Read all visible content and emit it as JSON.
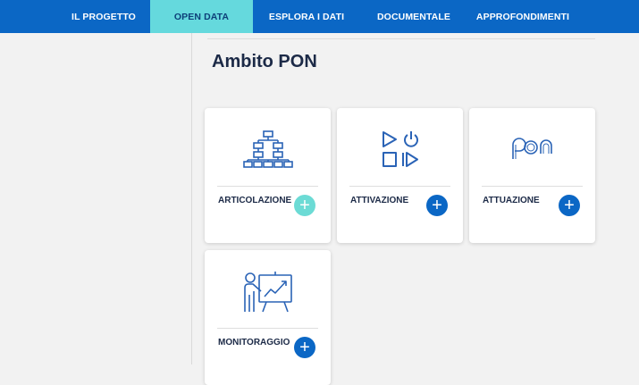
{
  "nav": {
    "items": [
      {
        "label": "IL PROGETTO"
      },
      {
        "label": "OPEN DATA"
      },
      {
        "label": "ESPLORA I DATI"
      },
      {
        "label": "DOCUMENTALE"
      },
      {
        "label": "APPROFONDIMENTI"
      }
    ],
    "active": "OPEN DATA"
  },
  "page": {
    "title": "Ambito PON"
  },
  "cards": [
    {
      "label": "ARTICOLAZIONE",
      "icon": "hierarchy-icon",
      "action": "+"
    },
    {
      "label": "ATTIVAZIONE",
      "icon": "play-power-icon",
      "action": "+"
    },
    {
      "label": "ATTUAZIONE",
      "icon": "pon-logo-icon",
      "action": "+"
    },
    {
      "label": "MONITORAGGIO",
      "icon": "presentation-chart-icon",
      "action": "+"
    }
  ],
  "colors": {
    "nav_background": "#0b67c5",
    "nav_active_background": "#65d9dd",
    "accent": "#0b67c5",
    "accent_light": "#6cdbd5",
    "title": "#1c2a47",
    "page_background": "#f2f2f2"
  }
}
